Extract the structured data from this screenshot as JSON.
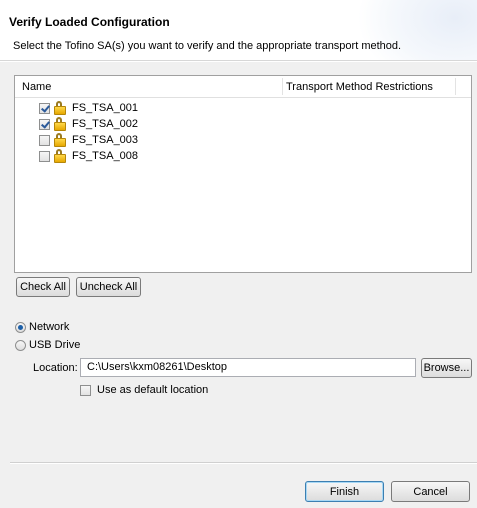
{
  "header": {
    "title": "Verify Loaded Configuration",
    "description": "Select the Tofino SA(s) you want to verify and the appropriate transport method."
  },
  "table": {
    "columns": [
      "Name",
      "Transport Method Restrictions"
    ],
    "rows": [
      {
        "name": "FS_TSA_001",
        "checked": true
      },
      {
        "name": "FS_TSA_002",
        "checked": true
      },
      {
        "name": "FS_TSA_003",
        "checked": false
      },
      {
        "name": "FS_TSA_008",
        "checked": false
      }
    ]
  },
  "buttons": {
    "check_all": "Check All",
    "uncheck_all": "Uncheck All",
    "browse": "Browse...",
    "finish": "Finish",
    "cancel": "Cancel"
  },
  "transport": {
    "network": "Network",
    "usb": "USB Drive",
    "selected": "Network"
  },
  "location": {
    "label": "Location:",
    "value": "C:\\Users\\kxm08261\\Desktop",
    "default_label": "Use as default location",
    "default_checked": false
  }
}
